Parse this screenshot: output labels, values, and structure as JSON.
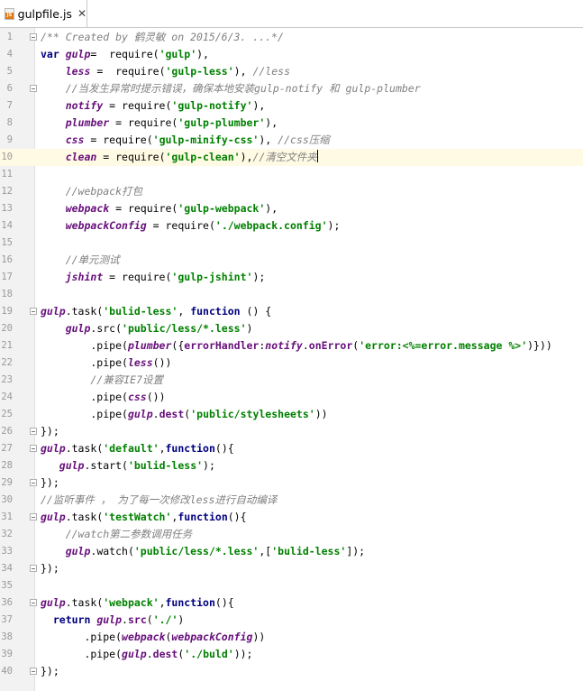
{
  "tab": {
    "icon": "javascript-file-icon",
    "icon_label": "JS",
    "title": "gulpfile.js",
    "close": "✕"
  },
  "current_line": 10,
  "lines": [
    {
      "n": "1",
      "tokens": [
        [
          "cm",
          "/** Created by 鹤灵敏 on 2015/6/3. ...*/"
        ]
      ],
      "fold": true
    },
    {
      "n": "4",
      "tokens": [
        [
          "kw",
          "var "
        ],
        [
          "var",
          "gulp"
        ],
        [
          "",
          "=  require("
        ],
        [
          "str",
          "'gulp'"
        ],
        [
          "",
          "),"
        ]
      ]
    },
    {
      "n": "5",
      "tokens": [
        [
          "",
          "    "
        ],
        [
          "var",
          "less"
        ],
        [
          "",
          " =  require("
        ],
        [
          "str",
          "'gulp-less'"
        ],
        [
          "",
          "), "
        ],
        [
          "cm",
          "//less"
        ]
      ]
    },
    {
      "n": "6",
      "tokens": [
        [
          "",
          "    "
        ],
        [
          "cm",
          "//当发生异常时提示错误，确保本地安装gulp-notify 和 gulp-plumber"
        ]
      ],
      "fold": true
    },
    {
      "n": "7",
      "tokens": [
        [
          "",
          "    "
        ],
        [
          "var",
          "notify"
        ],
        [
          "",
          " = require("
        ],
        [
          "str",
          "'gulp-notify'"
        ],
        [
          "",
          "),"
        ]
      ]
    },
    {
      "n": "8",
      "tokens": [
        [
          "",
          "    "
        ],
        [
          "var",
          "plumber"
        ],
        [
          "",
          " = require("
        ],
        [
          "str",
          "'gulp-plumber'"
        ],
        [
          "",
          "),"
        ]
      ]
    },
    {
      "n": "9",
      "tokens": [
        [
          "",
          "    "
        ],
        [
          "var",
          "css"
        ],
        [
          "",
          " = require("
        ],
        [
          "str",
          "'gulp-minify-css'"
        ],
        [
          "",
          "), "
        ],
        [
          "cm",
          "//css压缩"
        ]
      ]
    },
    {
      "n": "10",
      "tokens": [
        [
          "",
          "    "
        ],
        [
          "var",
          "clean"
        ],
        [
          "",
          " = require("
        ],
        [
          "str",
          "'gulp-clean'"
        ],
        [
          "",
          "),"
        ],
        [
          "cm",
          "//清空文件夹"
        ]
      ],
      "cursor": true
    },
    {
      "n": "11",
      "tokens": []
    },
    {
      "n": "12",
      "tokens": [
        [
          "",
          "    "
        ],
        [
          "cm",
          "//webpack打包"
        ]
      ]
    },
    {
      "n": "13",
      "tokens": [
        [
          "",
          "    "
        ],
        [
          "var",
          "webpack"
        ],
        [
          "",
          " = require("
        ],
        [
          "str",
          "'gulp-webpack'"
        ],
        [
          "",
          "),"
        ]
      ]
    },
    {
      "n": "14",
      "tokens": [
        [
          "",
          "    "
        ],
        [
          "var",
          "webpackConfig"
        ],
        [
          "",
          " = require("
        ],
        [
          "str",
          "'./webpack.config'"
        ],
        [
          "",
          ");"
        ]
      ]
    },
    {
      "n": "15",
      "tokens": []
    },
    {
      "n": "16",
      "tokens": [
        [
          "",
          "    "
        ],
        [
          "cm",
          "//单元测试"
        ]
      ]
    },
    {
      "n": "17",
      "tokens": [
        [
          "",
          "    "
        ],
        [
          "var",
          "jshint"
        ],
        [
          "",
          " = require("
        ],
        [
          "str",
          "'gulp-jshint'"
        ],
        [
          "",
          ");"
        ]
      ]
    },
    {
      "n": "18",
      "tokens": []
    },
    {
      "n": "19",
      "tokens": [
        [
          "var",
          "gulp"
        ],
        [
          "",
          ".task("
        ],
        [
          "str",
          "'bulid-less'"
        ],
        [
          "",
          ", "
        ],
        [
          "kw",
          "function"
        ],
        [
          "",
          " () {"
        ]
      ],
      "fold": true
    },
    {
      "n": "20",
      "tokens": [
        [
          "",
          "    "
        ],
        [
          "var",
          "gulp"
        ],
        [
          "",
          ".src("
        ],
        [
          "str",
          "'public/less/*.less'"
        ],
        [
          "",
          ")"
        ]
      ]
    },
    {
      "n": "21",
      "tokens": [
        [
          "",
          "        .pipe("
        ],
        [
          "var",
          "plumber"
        ],
        [
          "",
          "({"
        ],
        [
          "prop",
          "errorHandler"
        ],
        [
          "",
          ":"
        ],
        [
          "var",
          "notify"
        ],
        [
          "",
          "."
        ],
        [
          "prop",
          "onError"
        ],
        [
          "",
          "("
        ],
        [
          "str",
          "'error:<%=error.message %>'"
        ],
        [
          "",
          ")}))"
        ]
      ]
    },
    {
      "n": "22",
      "tokens": [
        [
          "",
          "        .pipe("
        ],
        [
          "var",
          "less"
        ],
        [
          "",
          "())"
        ]
      ]
    },
    {
      "n": "23",
      "tokens": [
        [
          "",
          "        "
        ],
        [
          "cm",
          "//兼容IE7设置"
        ]
      ]
    },
    {
      "n": "24",
      "tokens": [
        [
          "",
          "        .pipe("
        ],
        [
          "var",
          "css"
        ],
        [
          "",
          "())"
        ]
      ]
    },
    {
      "n": "25",
      "tokens": [
        [
          "",
          "        .pipe("
        ],
        [
          "var",
          "gulp"
        ],
        [
          "",
          "."
        ],
        [
          "prop",
          "dest"
        ],
        [
          "",
          "("
        ],
        [
          "str",
          "'public/stylesheets'"
        ],
        [
          "",
          "))"
        ]
      ]
    },
    {
      "n": "26",
      "tokens": [
        [
          "",
          "});"
        ]
      ],
      "fold": true
    },
    {
      "n": "27",
      "tokens": [
        [
          "var",
          "gulp"
        ],
        [
          "",
          ".task("
        ],
        [
          "str",
          "'default'"
        ],
        [
          "",
          ","
        ],
        [
          "kw",
          "function"
        ],
        [
          "",
          "(){"
        ]
      ],
      "fold": true
    },
    {
      "n": "28",
      "tokens": [
        [
          "",
          "   "
        ],
        [
          "var",
          "gulp"
        ],
        [
          "",
          ".start("
        ],
        [
          "str",
          "'bulid-less'"
        ],
        [
          "",
          ");"
        ]
      ]
    },
    {
      "n": "29",
      "tokens": [
        [
          "",
          "});"
        ]
      ],
      "fold": true
    },
    {
      "n": "30",
      "tokens": [
        [
          "cm",
          "//监听事件 ， 为了每一次修改less进行自动编译"
        ]
      ]
    },
    {
      "n": "31",
      "tokens": [
        [
          "var",
          "gulp"
        ],
        [
          "",
          ".task("
        ],
        [
          "str",
          "'testWatch'"
        ],
        [
          "",
          ","
        ],
        [
          "kw",
          "function"
        ],
        [
          "",
          "(){"
        ]
      ],
      "fold": true
    },
    {
      "n": "32",
      "tokens": [
        [
          "",
          "    "
        ],
        [
          "cm",
          "//watch第二参数调用任务"
        ]
      ]
    },
    {
      "n": "33",
      "tokens": [
        [
          "",
          "    "
        ],
        [
          "var",
          "gulp"
        ],
        [
          "",
          ".watch("
        ],
        [
          "str",
          "'public/less/*.less'"
        ],
        [
          "",
          ",["
        ],
        [
          "str",
          "'bulid-less'"
        ],
        [
          "",
          "]);"
        ]
      ]
    },
    {
      "n": "34",
      "tokens": [
        [
          "",
          "});"
        ]
      ],
      "fold": true
    },
    {
      "n": "35",
      "tokens": []
    },
    {
      "n": "36",
      "tokens": [
        [
          "var",
          "gulp"
        ],
        [
          "",
          ".task("
        ],
        [
          "str",
          "'webpack'"
        ],
        [
          "",
          ","
        ],
        [
          "kw",
          "function"
        ],
        [
          "",
          "(){"
        ]
      ],
      "fold": true
    },
    {
      "n": "37",
      "tokens": [
        [
          "",
          "  "
        ],
        [
          "kw",
          "return "
        ],
        [
          "var",
          "gulp"
        ],
        [
          "",
          "."
        ],
        [
          "prop",
          "src"
        ],
        [
          "",
          "("
        ],
        [
          "str",
          "'./'"
        ],
        [
          "",
          ")"
        ]
      ]
    },
    {
      "n": "38",
      "tokens": [
        [
          "",
          "       .pipe("
        ],
        [
          "var",
          "webpack"
        ],
        [
          "",
          "("
        ],
        [
          "var",
          "webpackConfig"
        ],
        [
          "",
          "))"
        ]
      ]
    },
    {
      "n": "39",
      "tokens": [
        [
          "",
          "       .pipe("
        ],
        [
          "var",
          "gulp"
        ],
        [
          "",
          "."
        ],
        [
          "prop",
          "dest"
        ],
        [
          "",
          "("
        ],
        [
          "str",
          "'./buld'"
        ],
        [
          "",
          "));"
        ]
      ]
    },
    {
      "n": "40",
      "tokens": [
        [
          "",
          "});"
        ]
      ],
      "fold": true
    }
  ]
}
